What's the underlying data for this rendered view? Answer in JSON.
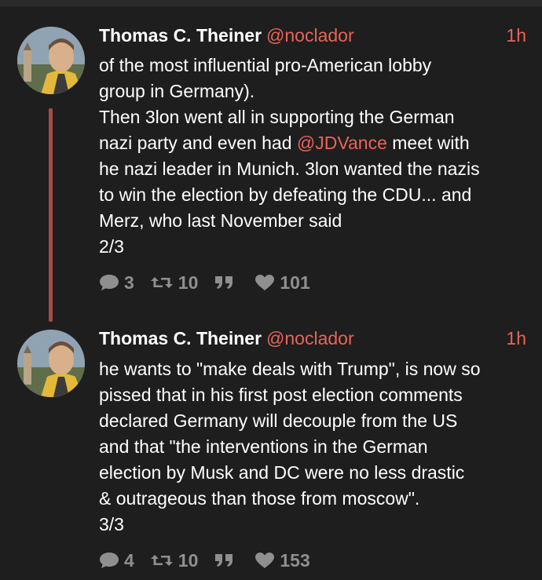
{
  "tweets": [
    {
      "name": "Thomas C. Theiner",
      "handle": "@noclador",
      "time": "1h",
      "lines": [
        "of the most influential pro-American lobby",
        "group in Germany).",
        "Then 3lon went all in supporting the German"
      ],
      "line4_mention": "@JDVance",
      "line4_pre": "nazi party and even had ",
      "line4_post": " meet with",
      "lines_after": [
        "he nazi leader in Munich. 3lon wanted the nazis",
        "to win the election by defeating the CDU... and",
        "Merz, who last November said",
        "2/3"
      ],
      "replies": "3",
      "retweets": "10",
      "likes": "101"
    },
    {
      "name": "Thomas C. Theiner",
      "handle": "@noclador",
      "time": "1h",
      "lines": [
        "he wants to \"make deals with Trump\", is now so",
        "pissed that in his first post election comments",
        "declared Germany will decouple from the US",
        "and that \"the interventions in the German",
        "election by Musk and DC were no less drastic",
        "& outrageous than those from moscow\".",
        "3/3"
      ],
      "replies": "4",
      "retweets": "10",
      "likes": "153"
    }
  ],
  "icons": {
    "reply": "speech-bubble-icon",
    "retweet": "retweet-icon",
    "quote": "quote-icon",
    "like": "heart-icon"
  },
  "colors": {
    "background": "#1e1e1e",
    "accent": "#e8645a",
    "thread_line": "#a84b47",
    "muted": "#8f8f8f"
  }
}
